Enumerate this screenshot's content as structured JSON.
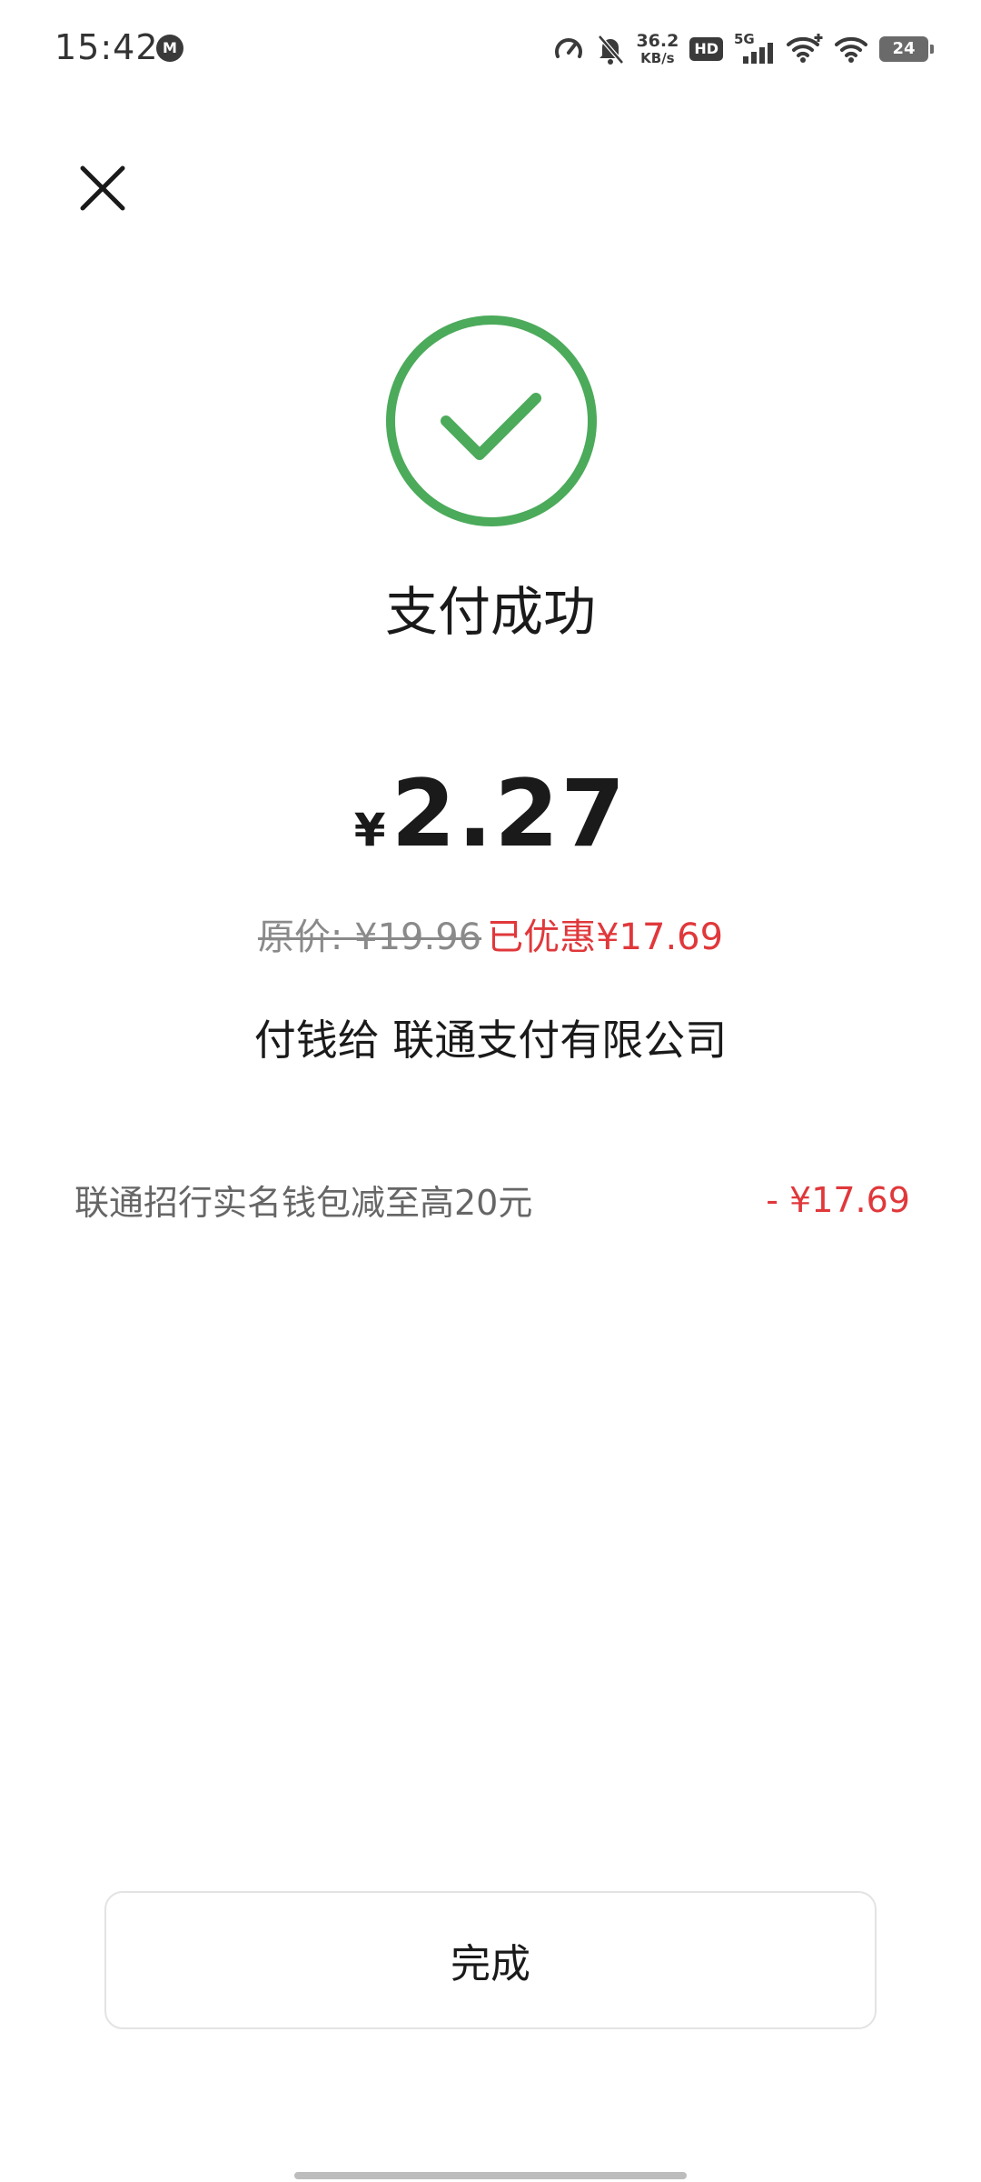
{
  "status_bar": {
    "time": "15:42",
    "net_speed_value": "36.2",
    "net_speed_unit": "KB/s",
    "hd_label": "HD",
    "network_label": "5G",
    "battery_level": "24",
    "icons": [
      "speedometer-icon",
      "mute-bell-icon",
      "signal-bars-icon",
      "wifi-plus-icon",
      "wifi-icon",
      "battery-icon"
    ]
  },
  "header": {
    "close_icon": "close-icon"
  },
  "result": {
    "icon": "check-circle-icon",
    "title": "支付成功",
    "success_color": "#4caa5b"
  },
  "amount": {
    "currency": "¥",
    "value": "2.27"
  },
  "price": {
    "original": "原价: ¥19.96",
    "discount": "已优惠¥17.69",
    "discount_color": "#e0383b"
  },
  "payee": {
    "text": "付钱给 联通支付有限公司"
  },
  "discount_detail": {
    "name": "联通招行实名钱包减至高20元",
    "amount": "- ¥17.69"
  },
  "actions": {
    "done_label": "完成"
  }
}
